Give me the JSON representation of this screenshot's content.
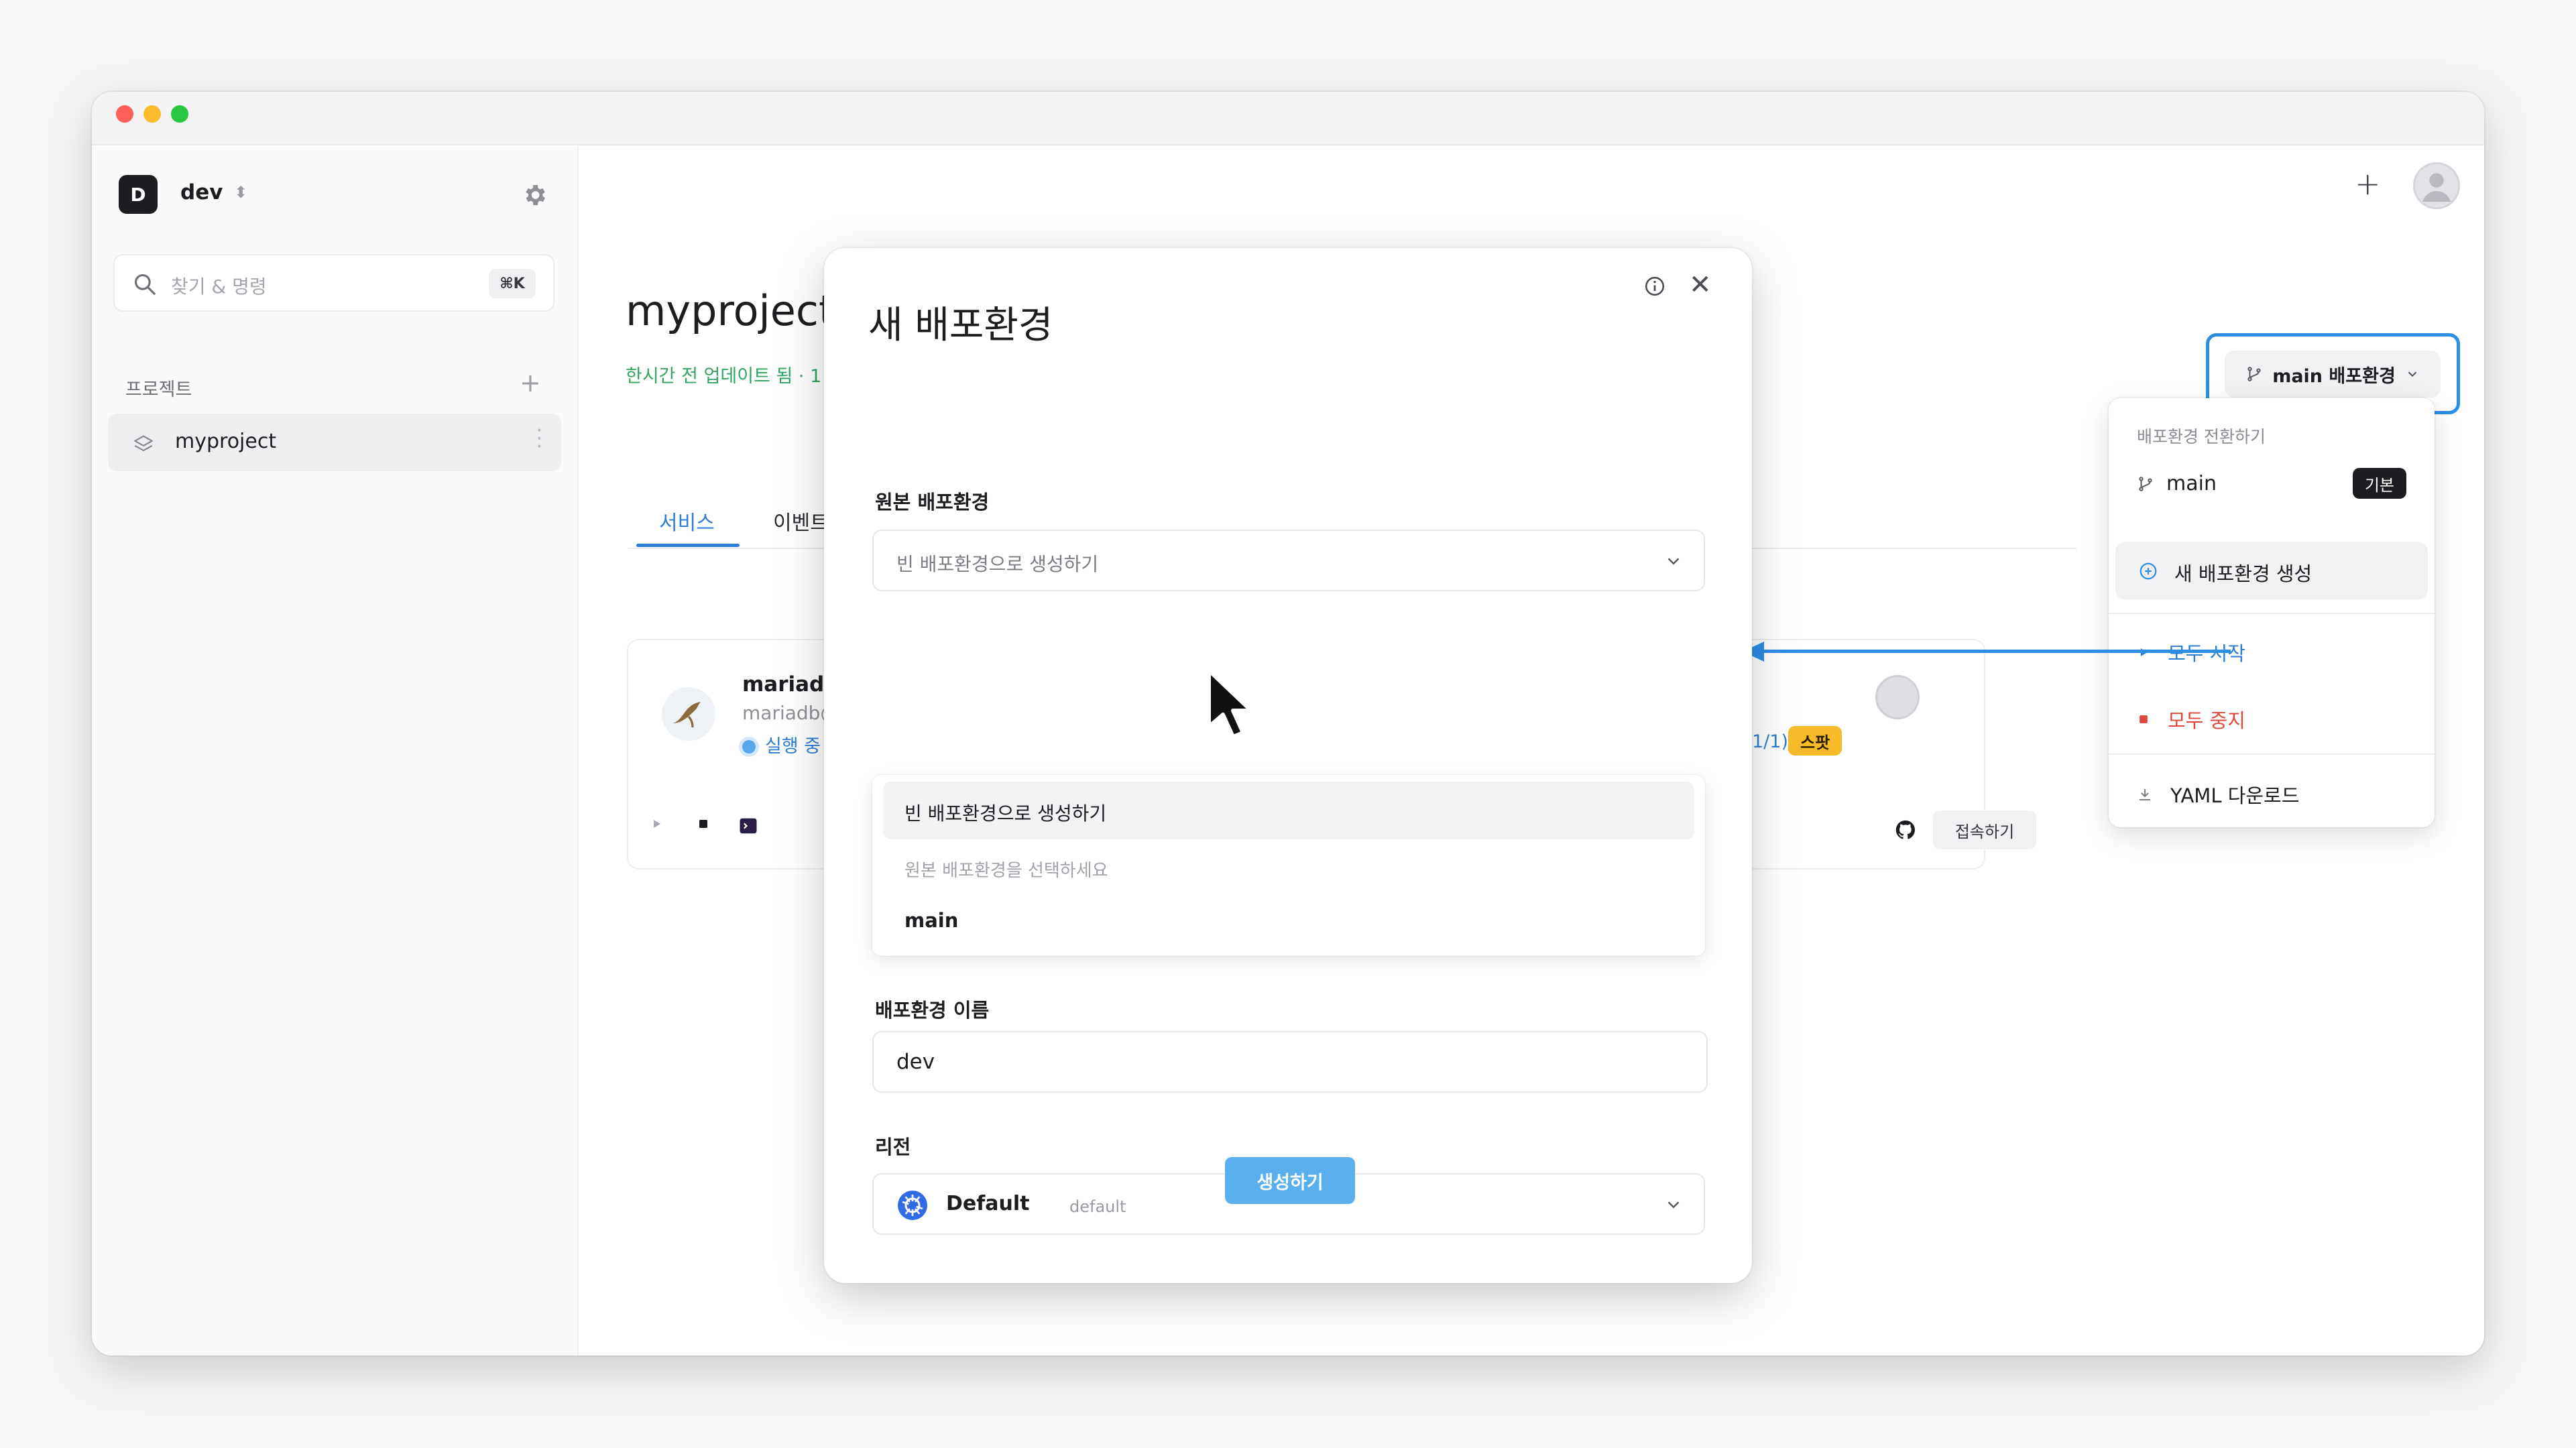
{
  "workspace": {
    "initial": "D",
    "name": "dev"
  },
  "search": {
    "placeholder": "찾기 & 명령",
    "shortcut": "⌘K"
  },
  "sidebar": {
    "section_label": "프로젝트",
    "projects": [
      {
        "label": "myproject"
      }
    ]
  },
  "project": {
    "title": "myproject",
    "updated": "한시간 전 업데이트 됨 · 1"
  },
  "tabs": [
    {
      "label": "서비스"
    },
    {
      "label": "이벤트"
    }
  ],
  "service": {
    "name": "mariadb",
    "sub": "mariadb@",
    "status": "실행 중",
    "ratio": "1/1)",
    "spot": "스팟",
    "connect": "접속하기"
  },
  "env_button": {
    "label": "main 배포환경"
  },
  "env_menu": {
    "header": "배포환경 전환하기",
    "main": "main",
    "default_badge": "기본",
    "new_env": "새 배포환경 생성",
    "start_all": "모두 시작",
    "stop_all": "모두 중지",
    "yaml": "YAML 다운로드"
  },
  "modal": {
    "title": "새 배포환경",
    "source_label": "원본 배포환경",
    "source_value": "빈 배포환경으로 생성하기",
    "dropdown": {
      "highlighted": "빈 배포환경으로 생성하기",
      "hint": "원본 배포환경을 선택하세요",
      "option_main": "main"
    },
    "name_label": "배포환경 이름",
    "name_value": "dev",
    "region_label": "리전",
    "region_value": "Default",
    "region_sub": "default",
    "submit": "생성하기"
  },
  "colors": {
    "accent": "#2d7fd6",
    "highlight_outline": "#2d8ee6",
    "updated_green": "#31a560",
    "danger": "#e0473a",
    "spot_badge": "#f7bb2a",
    "submit_button": "#5ab0ee"
  }
}
